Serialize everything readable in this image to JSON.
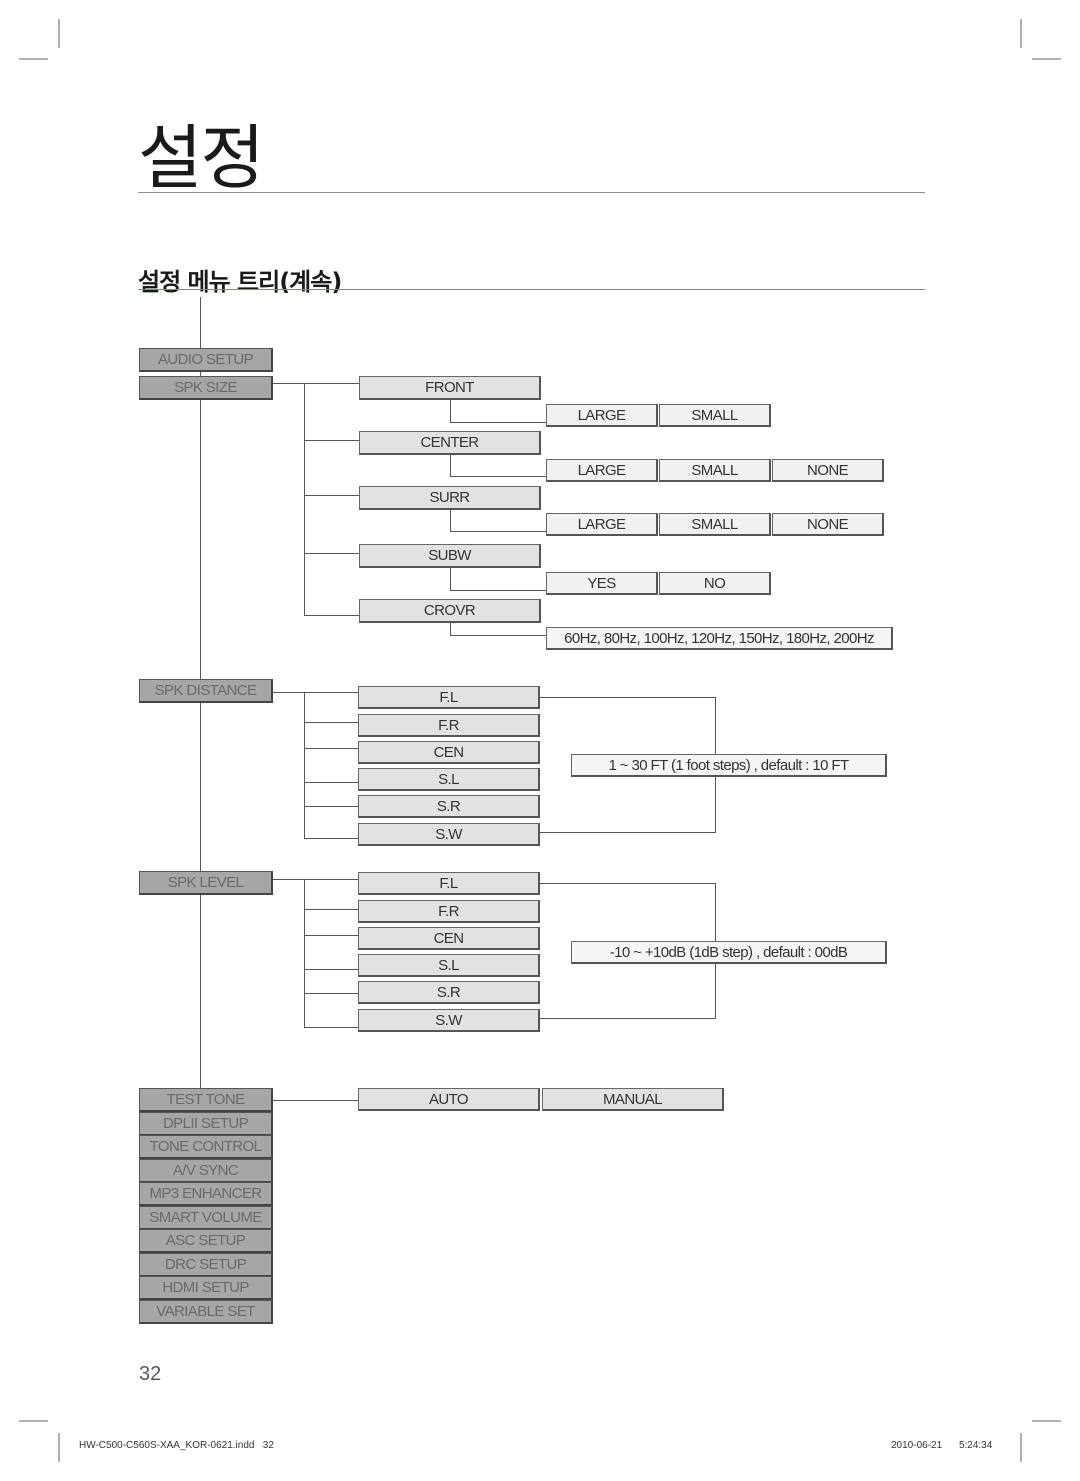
{
  "header": {
    "page_title": "설정",
    "section_title": "설정 메뉴 트리(계속)"
  },
  "menu_tree": {
    "root": "AUDIO SETUP",
    "spk_size": {
      "label": "SPK SIZE",
      "children": [
        {
          "label": "FRONT",
          "options": [
            "LARGE",
            "SMALL"
          ]
        },
        {
          "label": "CENTER",
          "options": [
            "LARGE",
            "SMALL",
            "NONE"
          ]
        },
        {
          "label": "SURR",
          "options": [
            "LARGE",
            "SMALL",
            "NONE"
          ]
        },
        {
          "label": "SUBW",
          "options": [
            "YES",
            "NO"
          ]
        },
        {
          "label": "CROVR",
          "options": [
            "60Hz, 80Hz, 100Hz, 120Hz, 150Hz, 180Hz, 200Hz"
          ]
        }
      ]
    },
    "spk_distance": {
      "label": "SPK DISTANCE",
      "channels": [
        "F.L",
        "F.R",
        "CEN",
        "S.L",
        "S.R",
        "S.W"
      ],
      "range": "1 ~ 30 FT (1 foot steps) , default : 10 FT"
    },
    "spk_level": {
      "label": "SPK LEVEL",
      "channels": [
        "F.L",
        "F.R",
        "CEN",
        "S.L",
        "S.R",
        "S.W"
      ],
      "range": "-10 ~ +10dB (1dB step) , default : 00dB"
    },
    "test_tone": {
      "label": "TEST TONE",
      "options": [
        "AUTO",
        "MANUAL"
      ]
    },
    "other_items": [
      "DPLII SETUP",
      "TONE CONTROL",
      "A/V SYNC",
      "MP3 ENHANCER",
      "SMART VOLUME",
      "ASC SETUP",
      "DRC SETUP",
      "HDMI SETUP",
      "VARIABLE SET"
    ]
  },
  "footer": {
    "page_number": "32",
    "file_info": "HW-C500-C560S-XAA_KOR-0621.indd   32",
    "date": "2010-06-21",
    "time": "5:24:34"
  },
  "colors": {
    "dark_box": "#a6a6a8",
    "mid_box": "#e2e2e4",
    "light_box": "#f1f1f1",
    "line": "#555555"
  }
}
